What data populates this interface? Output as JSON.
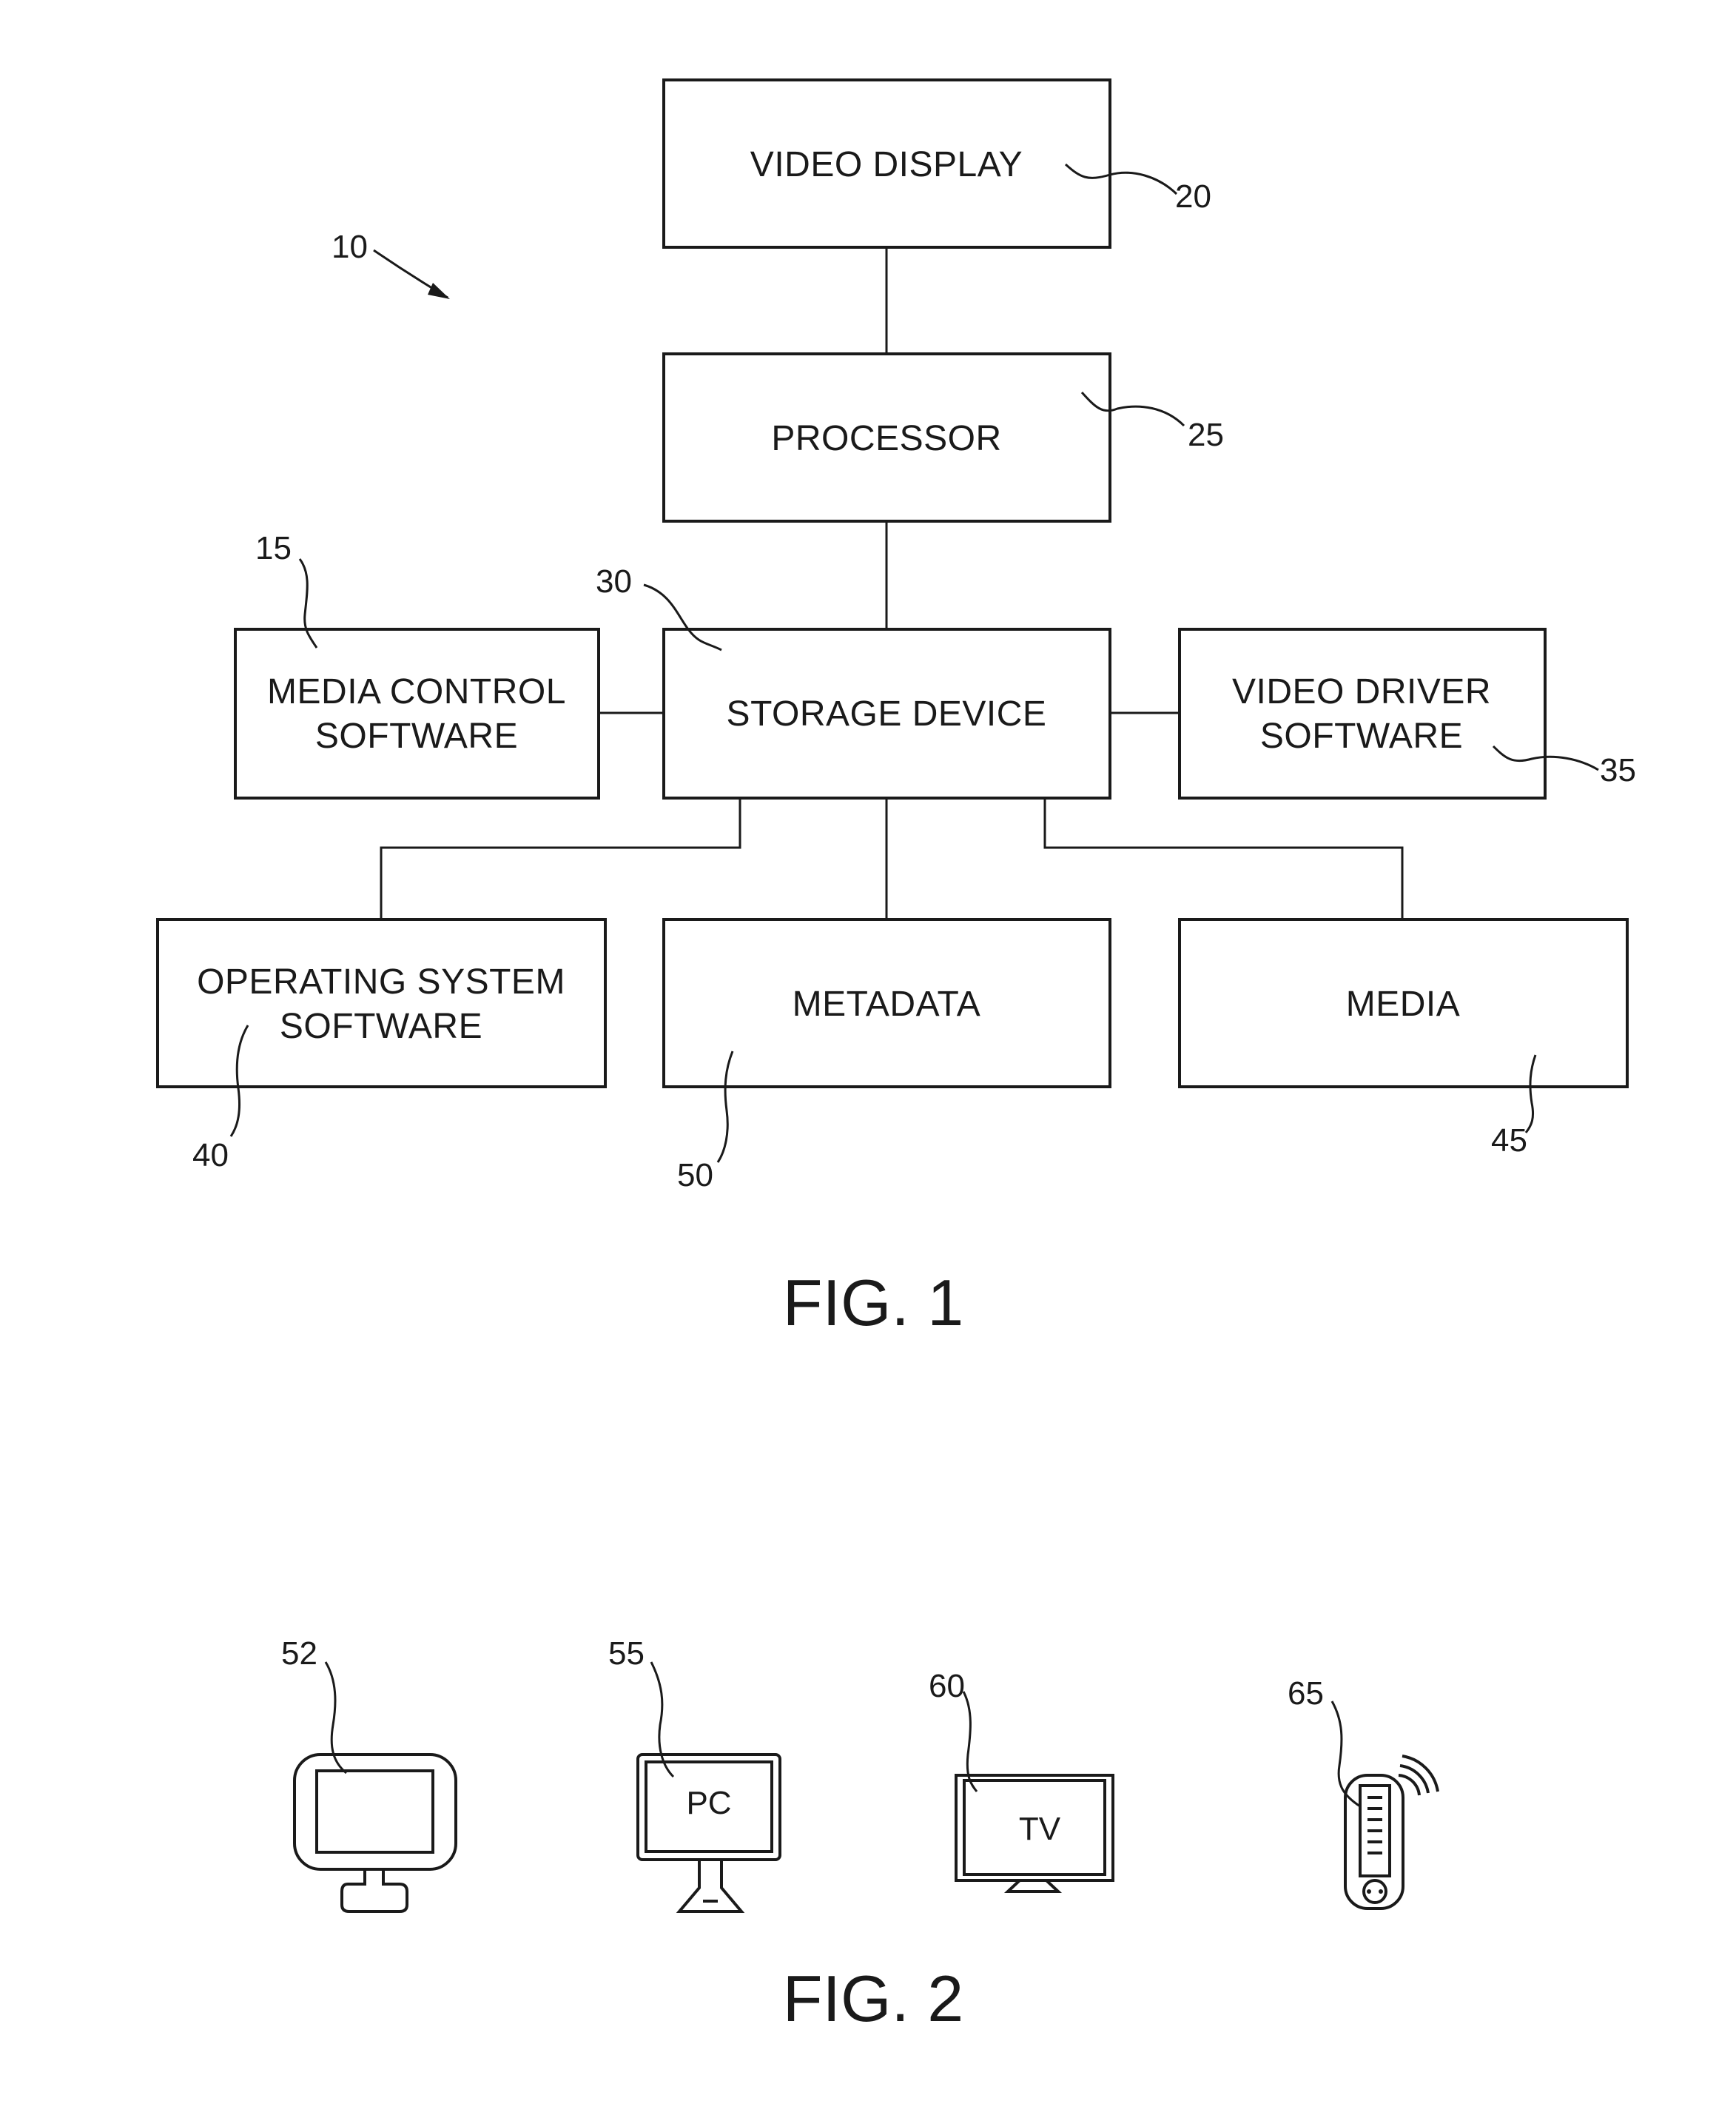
{
  "figure1": {
    "caption": "FIG. 1",
    "system_ref": "10",
    "blocks": [
      {
        "id": "video_display",
        "label_lines": [
          "VIDEO DISPLAY"
        ],
        "ref": "20"
      },
      {
        "id": "processor",
        "label_lines": [
          "PROCESSOR"
        ],
        "ref": "25"
      },
      {
        "id": "storage_device",
        "label_lines": [
          "STORAGE DEVICE"
        ],
        "ref": "30"
      },
      {
        "id": "media_control_software",
        "label_lines": [
          "MEDIA CONTROL",
          "SOFTWARE"
        ],
        "ref": "15"
      },
      {
        "id": "video_driver_software",
        "label_lines": [
          "VIDEO DRIVER",
          "SOFTWARE"
        ],
        "ref": "35"
      },
      {
        "id": "operating_system_software",
        "label_lines": [
          "OPERATING SYSTEM",
          "SOFTWARE"
        ],
        "ref": "40"
      },
      {
        "id": "metadata",
        "label_lines": [
          "METADATA"
        ],
        "ref": "50"
      },
      {
        "id": "media",
        "label_lines": [
          "MEDIA"
        ],
        "ref": "45"
      }
    ],
    "connections": [
      [
        "video_display",
        "processor"
      ],
      [
        "processor",
        "storage_device"
      ],
      [
        "media_control_software",
        "storage_device"
      ],
      [
        "storage_device",
        "video_driver_software"
      ],
      [
        "storage_device",
        "operating_system_software"
      ],
      [
        "storage_device",
        "metadata"
      ],
      [
        "storage_device",
        "media"
      ]
    ]
  },
  "figure2": {
    "caption": "FIG. 2",
    "devices": [
      {
        "id": "monitor",
        "ref": "52",
        "screen_text": ""
      },
      {
        "id": "pc",
        "ref": "55",
        "screen_text": "PC"
      },
      {
        "id": "tv",
        "ref": "60",
        "screen_text": "TV"
      },
      {
        "id": "mobile",
        "ref": "65",
        "screen_text": ""
      }
    ]
  }
}
